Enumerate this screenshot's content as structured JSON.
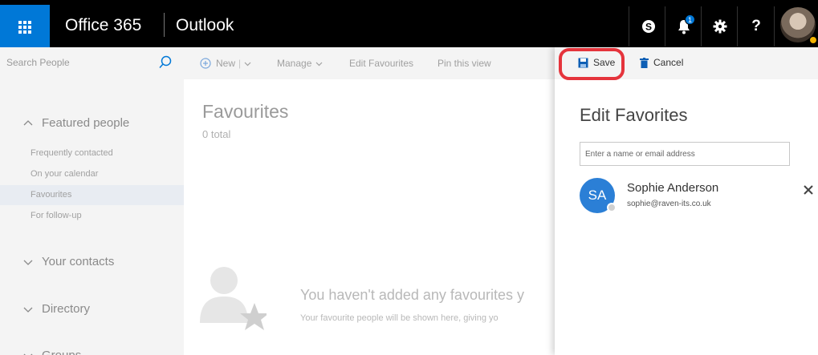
{
  "header": {
    "brand": "Office 365",
    "app": "Outlook",
    "notification_count": "1",
    "help": "?"
  },
  "sidebar": {
    "search_placeholder": "Search People",
    "featured": "Featured people",
    "items": [
      "Frequently contacted",
      "On your calendar",
      "Favourites",
      "For follow-up"
    ],
    "your_contacts": "Your contacts",
    "directory": "Directory",
    "groups": "Groups"
  },
  "toolbar": {
    "new": "New",
    "manage": "Manage",
    "edit_favourites": "Edit Favourites",
    "pin": "Pin this view"
  },
  "main": {
    "title": "Favourites",
    "count": "0 total",
    "empty_title": "You haven't added any favourites y",
    "empty_sub": "Your favourite people will be shown here, giving yo"
  },
  "panel": {
    "save": "Save",
    "cancel": "Cancel",
    "title": "Edit Favorites",
    "input_placeholder": "Enter a name or email address",
    "person": {
      "initials": "SA",
      "name": "Sophie Anderson",
      "email": "sophie@raven-its.co.uk"
    }
  },
  "colors": {
    "accent": "#0078d7",
    "highlight": "#e5343c",
    "avatar_bg": "#2b7fd6"
  }
}
